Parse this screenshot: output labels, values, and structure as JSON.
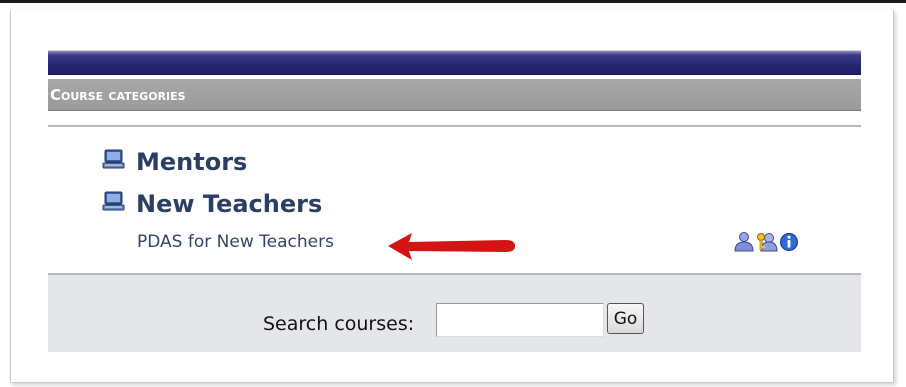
{
  "block": {
    "header_title": "Course categories"
  },
  "categories": [
    {
      "label": "Mentors",
      "icon": "category-icon"
    },
    {
      "label": "New Teachers",
      "icon": "category-icon"
    }
  ],
  "course": {
    "name": "PDAS for New Teachers",
    "icons": [
      "teacher-person-icon",
      "guest-access-key-icon",
      "info-icon"
    ]
  },
  "annotation": {
    "arrow_color": "#d41414"
  },
  "search": {
    "label": "Search courses:",
    "value": "",
    "button_label": "Go"
  },
  "colors": {
    "header_bar": "#262670",
    "category_header": "#a0a0a0",
    "link_text": "#32466b",
    "search_background": "#e4e6ea"
  }
}
